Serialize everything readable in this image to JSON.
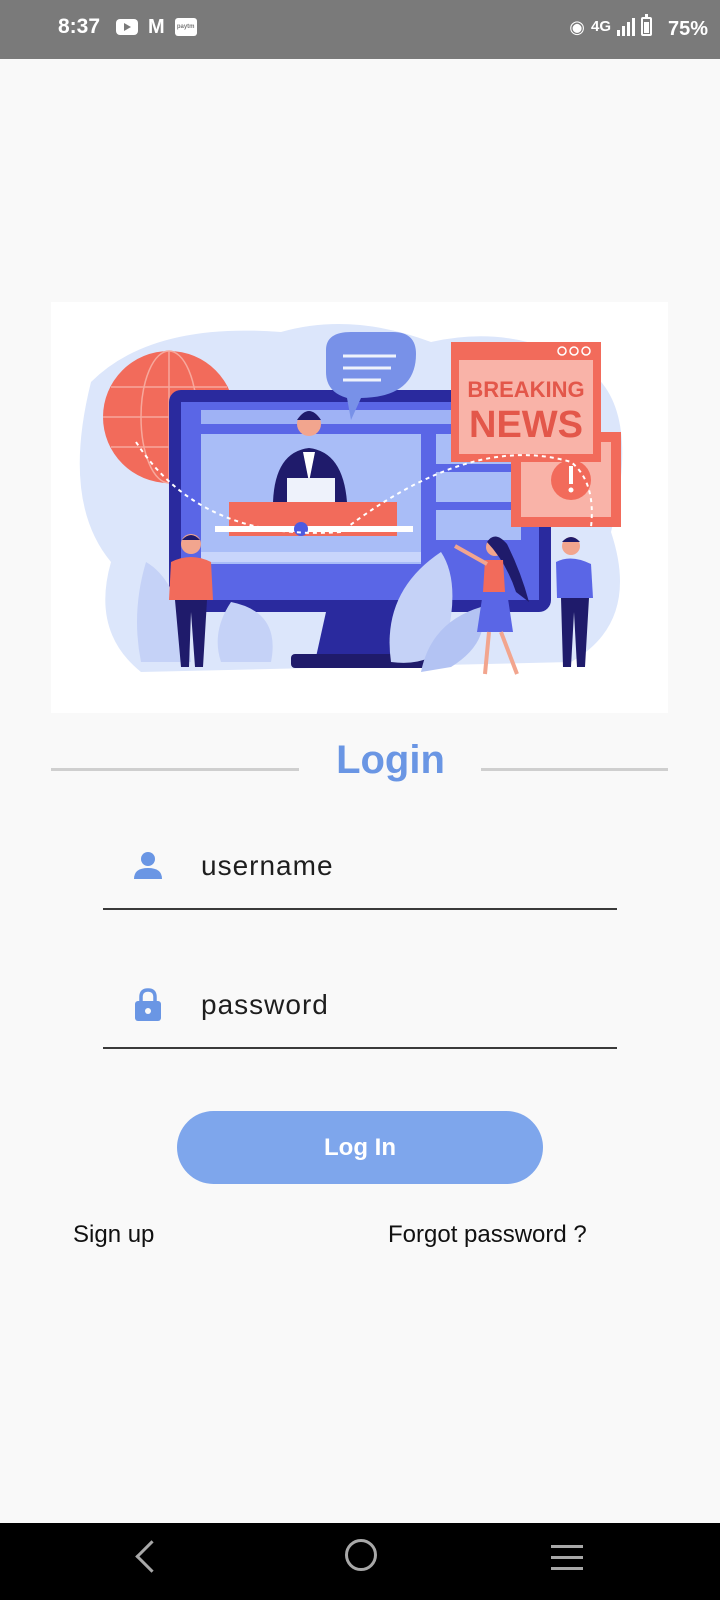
{
  "status_bar": {
    "time": "8:37",
    "network": "4G",
    "battery": "75%",
    "icons": [
      "youtube-icon",
      "gmail-icon",
      "paytm-icon",
      "hotspot-icon",
      "signal-icon",
      "battery-icon"
    ]
  },
  "illustration": {
    "headline_line1": "BREAKING",
    "headline_line2": "NEWS"
  },
  "login": {
    "title": "Login",
    "username_placeholder": "username",
    "password_placeholder": "password",
    "button_label": "Log In",
    "signup_label": "Sign up",
    "forgot_label": "Forgot password ?"
  },
  "colors": {
    "accent": "#6a96e4",
    "button": "#7ea6ec",
    "illustration_red": "#f26b5b",
    "illustration_navy": "#1f1b6b"
  }
}
